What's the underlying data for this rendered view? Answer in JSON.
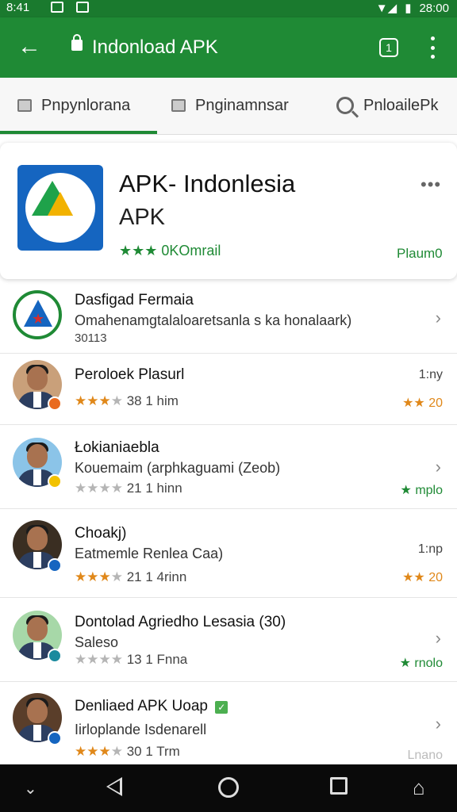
{
  "status_bar": {
    "time_left": "8:41",
    "time_right": "28:00"
  },
  "app_bar": {
    "url": "Indonload APK"
  },
  "tabs": [
    {
      "label": "Pnpynlorana",
      "icon": "tab-page-icon"
    },
    {
      "label": "Pnginamnsar",
      "icon": "tab-page-icon"
    },
    {
      "label": "PnloailePk",
      "icon": "search-icon"
    }
  ],
  "header": {
    "title": "APK- Indonlesia",
    "subtitle": "APK",
    "rating_text": "★★★ 0KOmrail",
    "action": "Plaum0",
    "more": "•••"
  },
  "list": [
    {
      "title": "Dasfigad Fermaia",
      "subtitle": "Omahenamgtalaloaretsanla s ka honalaark)",
      "third": "30113",
      "right": "›",
      "right_type": "chev"
    },
    {
      "title": "Peroloek Plasurl",
      "stars": "★★★",
      "stars_grey": "★",
      "rating": "38 1 him",
      "right_top": "1:ny",
      "right_bottom": "★★ 20",
      "right_type": "gold"
    },
    {
      "title": "Łokianiaebla",
      "subtitle": "Kouemaim (arphkaguami (Zeob)",
      "stars": "",
      "stars_grey": "★★★★",
      "rating": "21 1 hinn",
      "right_top": "›",
      "right_bottom": "★ mplo",
      "right_type": "green"
    },
    {
      "title": "Choakj)",
      "subtitle": "Eatmemle Renlea Caa)",
      "stars": "★★★",
      "stars_grey": "★",
      "rating": "21 1 4rinn",
      "right_top": "1:np",
      "right_bottom": "★★ 20",
      "right_type": "gold"
    },
    {
      "title": "Dontolad Agriedho Lesasia (30)",
      "subtitle": "Saleso",
      "stars": "",
      "stars_grey": "★★★★",
      "rating": "13 1 Fnna",
      "right_top": "›",
      "right_bottom": "★ rnolo",
      "right_type": "green"
    },
    {
      "title": "Denliaed APK Uoap",
      "subtitle": "Iirloplande Isdenarell",
      "stars": "★★★",
      "stars_grey": "★",
      "rating": "30 1 Trm",
      "right_top": "›",
      "right_bottom": "Lnano",
      "right_type": "faint"
    }
  ],
  "colors": {
    "primary": "#1f8a35",
    "star": "#e0881a"
  }
}
